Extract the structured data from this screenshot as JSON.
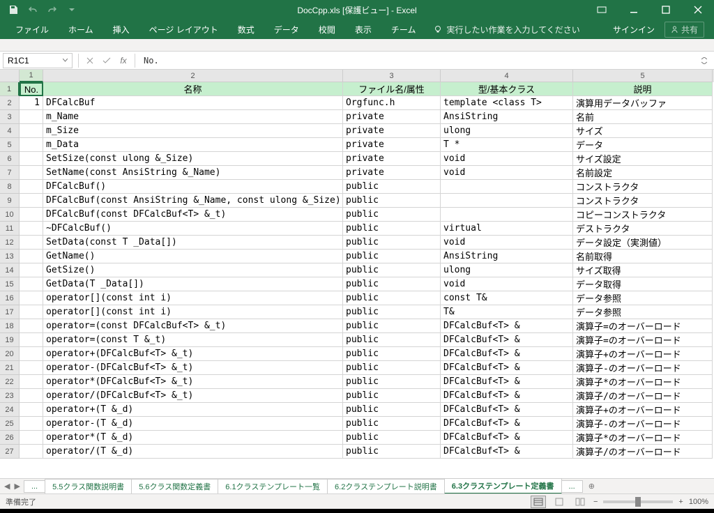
{
  "titlebar": {
    "title": "DocCpp.xls [保護ビュー] - Excel",
    "restore_icon": "⧉"
  },
  "ribbon": {
    "tabs": [
      "ファイル",
      "ホーム",
      "挿入",
      "ページ レイアウト",
      "数式",
      "データ",
      "校閲",
      "表示",
      "チーム"
    ],
    "tellme": "実行したい作業を入力してください",
    "signin": "サインイン",
    "share": "共有"
  },
  "formula_bar": {
    "name_box": "R1C1",
    "fx_label": "fx",
    "value": "No."
  },
  "columns": [
    "1",
    "2",
    "3",
    "4",
    "5"
  ],
  "header_row": [
    "No.",
    "名称",
    "ファイル名/属性",
    "型/基本クラス",
    "説明"
  ],
  "rows": [
    {
      "n": "2",
      "c": [
        "1",
        "DFCalcBuf",
        "Orgfunc.h",
        "template <class T>",
        "演算用データバッファ"
      ]
    },
    {
      "n": "3",
      "c": [
        "",
        "m_Name",
        "private",
        "AnsiString",
        "名前"
      ]
    },
    {
      "n": "4",
      "c": [
        "",
        "m_Size",
        "private",
        "ulong",
        "サイズ"
      ]
    },
    {
      "n": "5",
      "c": [
        "",
        "m_Data",
        "private",
        "T *",
        "データ"
      ]
    },
    {
      "n": "6",
      "c": [
        "",
        "SetSize(const ulong &_Size)",
        "private",
        "void",
        "サイズ設定"
      ]
    },
    {
      "n": "7",
      "c": [
        "",
        "SetName(const AnsiString &_Name)",
        "private",
        "void",
        "名前設定"
      ]
    },
    {
      "n": "8",
      "c": [
        "",
        "DFCalcBuf()",
        "public",
        "",
        "コンストラクタ"
      ]
    },
    {
      "n": "9",
      "c": [
        "",
        "DFCalcBuf(const AnsiString &_Name, const ulong &_Size)",
        "public",
        "",
        "コンストラクタ"
      ]
    },
    {
      "n": "10",
      "c": [
        "",
        "DFCalcBuf(const DFCalcBuf<T> &_t)",
        "public",
        "",
        "コピーコンストラクタ"
      ]
    },
    {
      "n": "11",
      "c": [
        "",
        "~DFCalcBuf()",
        "public",
        "virtual",
        "デストラクタ"
      ]
    },
    {
      "n": "12",
      "c": [
        "",
        "SetData(const T _Data[])",
        "public",
        "void",
        "データ設定（実測値）"
      ]
    },
    {
      "n": "13",
      "c": [
        "",
        "GetName()",
        "public",
        "AnsiString",
        "名前取得"
      ]
    },
    {
      "n": "14",
      "c": [
        "",
        "GetSize()",
        "public",
        "ulong",
        "サイズ取得"
      ]
    },
    {
      "n": "15",
      "c": [
        "",
        "GetData(T _Data[])",
        "public",
        "void",
        "データ取得"
      ]
    },
    {
      "n": "16",
      "c": [
        "",
        "operator[](const int i)",
        "public",
        "const T&",
        "データ参照"
      ]
    },
    {
      "n": "17",
      "c": [
        "",
        "operator[](const int i)",
        "public",
        "T&",
        "データ参照"
      ]
    },
    {
      "n": "18",
      "c": [
        "",
        "operator=(const DFCalcBuf<T> &_t)",
        "public",
        "DFCalcBuf<T> &",
        "演算子=のオーバーロード"
      ]
    },
    {
      "n": "19",
      "c": [
        "",
        "operator=(const T &_t)",
        "public",
        "DFCalcBuf<T> &",
        "演算子=のオーバーロード"
      ]
    },
    {
      "n": "20",
      "c": [
        "",
        "operator+(DFCalcBuf<T> &_t)",
        "public",
        "DFCalcBuf<T> &",
        "演算子+のオーバーロード"
      ]
    },
    {
      "n": "21",
      "c": [
        "",
        "operator-(DFCalcBuf<T> &_t)",
        "public",
        "DFCalcBuf<T> &",
        "演算子-のオーバーロード"
      ]
    },
    {
      "n": "22",
      "c": [
        "",
        "operator*(DFCalcBuf<T> &_t)",
        "public",
        "DFCalcBuf<T> &",
        "演算子*のオーバーロード"
      ]
    },
    {
      "n": "23",
      "c": [
        "",
        "operator/(DFCalcBuf<T> &_t)",
        "public",
        "DFCalcBuf<T> &",
        "演算子/のオーバーロード"
      ]
    },
    {
      "n": "24",
      "c": [
        "",
        "operator+(T &_d)",
        "public",
        "DFCalcBuf<T> &",
        "演算子+のオーバーロード"
      ]
    },
    {
      "n": "25",
      "c": [
        "",
        "operator-(T &_d)",
        "public",
        "DFCalcBuf<T> &",
        "演算子-のオーバーロード"
      ]
    },
    {
      "n": "26",
      "c": [
        "",
        "operator*(T &_d)",
        "public",
        "DFCalcBuf<T> &",
        "演算子*のオーバーロード"
      ]
    },
    {
      "n": "27",
      "c": [
        "",
        "operator/(T &_d)",
        "public",
        "DFCalcBuf<T> &",
        "演算子/のオーバーロード"
      ]
    }
  ],
  "sheet_tabs": {
    "leading": "...",
    "tabs": [
      "5.5クラス関数説明書",
      "5.6クラス関数定義書",
      "6.1クラステンプレート一覧",
      "6.2クラステンプレート説明書",
      "6.3クラステンプレート定義書"
    ],
    "selected": 4,
    "trailing": "..."
  },
  "status_bar": {
    "ready": "準備完了",
    "zoom": "100%"
  }
}
